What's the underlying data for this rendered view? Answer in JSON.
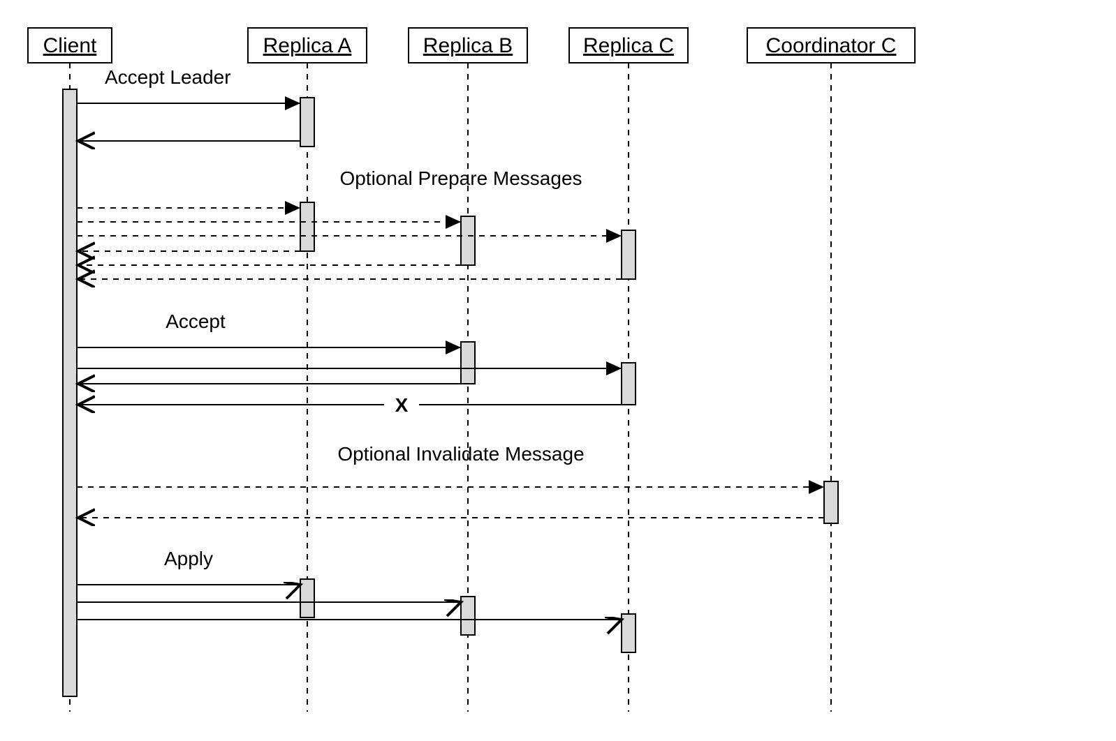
{
  "participants": {
    "client": "Client",
    "replicaA": "Replica A",
    "replicaB": "Replica B",
    "replicaC": "Replica C",
    "coordinatorC": "Coordinator C"
  },
  "labels": {
    "acceptLeader": "Accept Leader",
    "optionalPrepare": "Optional Prepare Messages",
    "accept": "Accept",
    "failMark": "X",
    "optionalInvalidate": "Optional Invalidate Message",
    "apply": "Apply"
  },
  "diagram": {
    "type": "UML Sequence Diagram",
    "description": "Client coordinates with replicas A, B, C via leader accept, optional prepare, accept (with a failed response), optional invalidate to Coordinator C, then apply to all replicas."
  }
}
